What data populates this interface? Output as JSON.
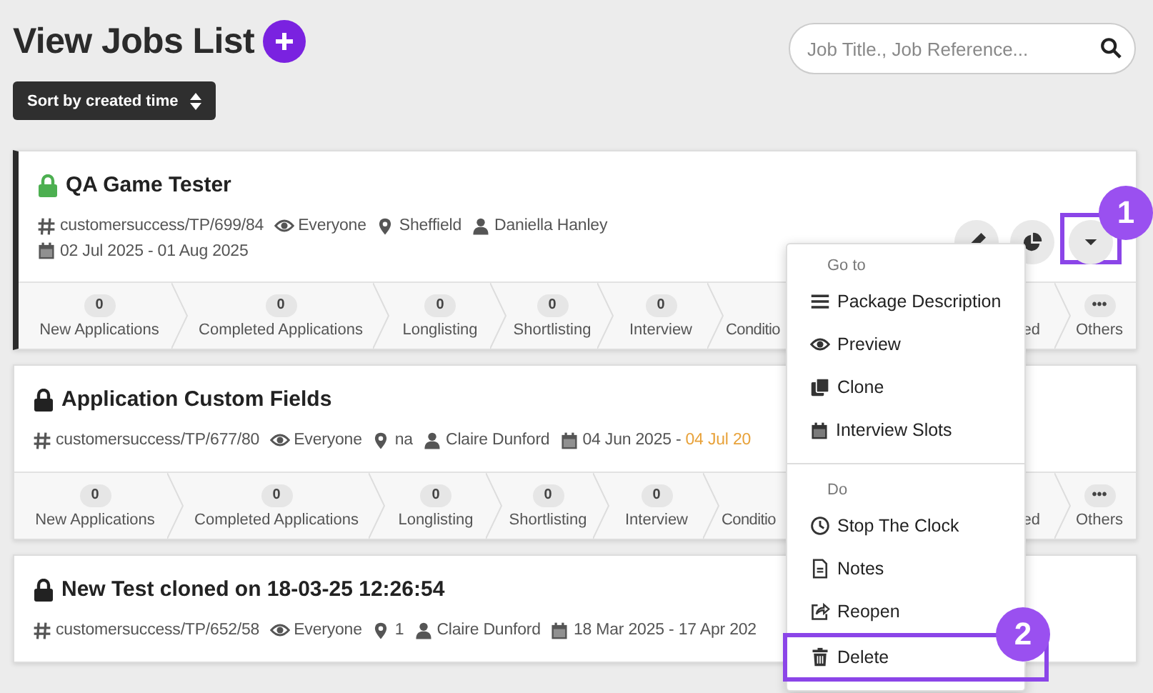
{
  "header": {
    "title": "View Jobs List",
    "sort_label": "Sort by created time",
    "search": {
      "placeholder": "Job Title., Job Reference..."
    }
  },
  "jobs": [
    {
      "title": "QA Game Tester",
      "color": "#4caf50",
      "selected": true,
      "reference": "customersuccess/TP/699/84",
      "visibility": "Everyone",
      "location": "Sheffield",
      "owner": "Daniella Hanley",
      "dates": "02 Jul 2025 - 01 Aug 2025",
      "actions": [
        {
          "kind": "edit"
        },
        {
          "kind": "stats"
        },
        {
          "kind": "more",
          "callout": "1"
        }
      ],
      "stages": [
        {
          "count": "0",
          "label": "New Applications"
        },
        {
          "count": "0",
          "label": "Completed Applications"
        },
        {
          "count": "0",
          "label": "Longlisting"
        },
        {
          "count": "0",
          "label": "Shortlisting"
        },
        {
          "count": "0",
          "label": "Interview"
        },
        {
          "label": "Conditio"
        },
        {
          "label": "ed"
        },
        {
          "count": "•••",
          "label": "Others"
        }
      ]
    },
    {
      "title": "Application Custom Fields",
      "color": "#222222",
      "selected": false,
      "reference": "customersuccess/TP/677/80",
      "visibility": "Everyone",
      "location": "na",
      "owner": "Claire Dunford",
      "dates": "04 Jun 2025 - ",
      "end_date": "04 Jul 20",
      "end_warning": true,
      "stages": [
        {
          "count": "0",
          "label": "New Applications"
        },
        {
          "count": "0",
          "label": "Completed Applications"
        },
        {
          "count": "0",
          "label": "Longlisting"
        },
        {
          "count": "0",
          "label": "Shortlisting"
        },
        {
          "count": "0",
          "label": "Interview"
        },
        {
          "label": "Conditio"
        },
        {
          "label": "ed"
        },
        {
          "count": "•••",
          "label": "Others"
        }
      ]
    },
    {
      "title": "New Test cloned on 18-03-25 12:26:54",
      "color": "#222222",
      "selected": false,
      "reference": "customersuccess/TP/652/58",
      "visibility": "Everyone",
      "location": "1",
      "owner": "Claire Dunford",
      "dates": "18 Mar 2025 - 17 Apr 202"
    }
  ],
  "menu": {
    "sections": [
      {
        "heading": "Go to",
        "items": [
          {
            "label": "Package Description"
          },
          {
            "label": "Preview"
          },
          {
            "label": "Clone"
          },
          {
            "label": "Interview Slots"
          }
        ]
      },
      {
        "heading": "Do",
        "items": [
          {
            "label": "Stop The Clock"
          },
          {
            "label": "Notes"
          },
          {
            "label": "Reopen"
          },
          {
            "label": "Delete",
            "callout": "2"
          }
        ]
      }
    ]
  }
}
